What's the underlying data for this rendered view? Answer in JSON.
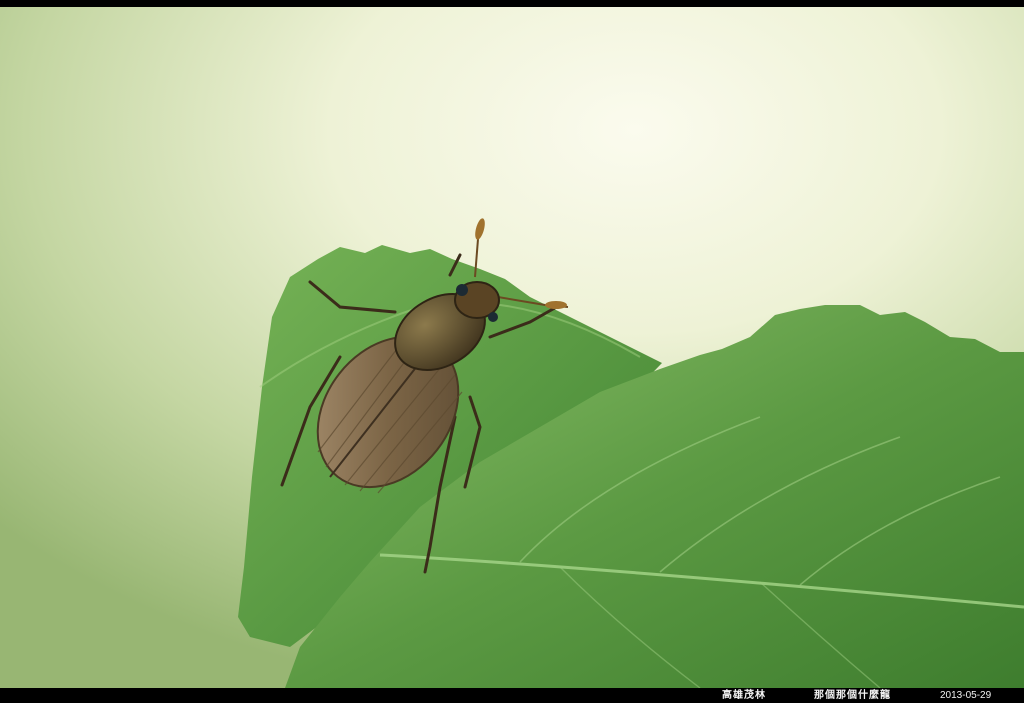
{
  "photo": {
    "subject": "beetle-on-leaf",
    "colors": {
      "background_light": "#f6f8e4",
      "background_green": "#a7c27f",
      "leaf_main": "#5f9a3f",
      "leaf_dark": "#3f7d2c",
      "beetle_shell": "#8a7454",
      "beetle_dark": "#4a3a24"
    }
  },
  "caption": {
    "location": "高雄茂林",
    "title": "那個那個什麼龍",
    "date": "2013-05-29"
  }
}
